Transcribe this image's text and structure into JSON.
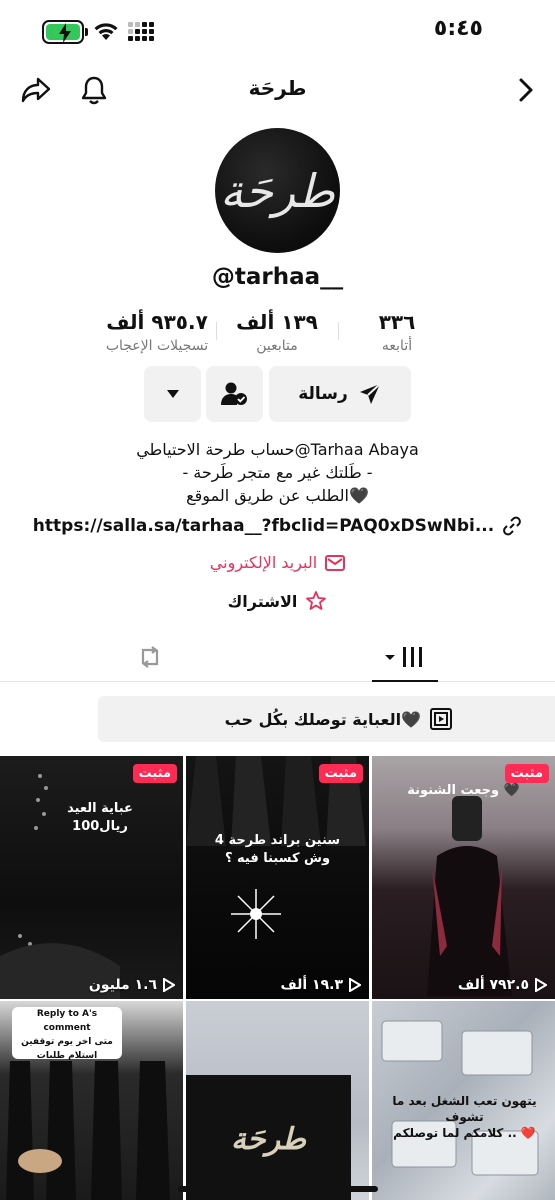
{
  "status_bar": {
    "time": "٥:٤٥"
  },
  "header": {
    "title": "طرحَة"
  },
  "profile": {
    "username": "@tarhaa__",
    "avatar_label": "طرحَة",
    "stats": [
      {
        "value": "٣٣٦",
        "label": "أتابعه"
      },
      {
        "value": "١٣٩ ألف",
        "label": "متابعين"
      },
      {
        "value": "٩٣٥.٧ ألف",
        "label": "تسجيلات الإعجاب"
      }
    ],
    "message_label": "رسالة",
    "bio_lines": [
      "حساب طرحة الاحتياطي@Tarhaa Abaya",
      "- طَلتك غير مع متجر طَرحة -",
      "الطلب عن طريق الموقع🖤"
    ],
    "link": "https://salla.sa/tarhaa__?fbclid=PAQ0xDSwNbi...",
    "email_label": "البريد الإلكتروني",
    "subscribe_label": "الاشتراك"
  },
  "playlist": {
    "label": "العباية توصلك بكُل حب🖤"
  },
  "videos": [
    {
      "badge": "مثبت",
      "views": "١.٦ مليون",
      "caption": "عباية العيد\n100ريال"
    },
    {
      "badge": "مثبت",
      "views": "١٩.٣ ألف",
      "caption": "4 سنين براند طرحة\nوش كسبنا فيه ؟"
    },
    {
      "badge": "مثبت",
      "views": "٧٩٢.٥ ألف",
      "caption": "وجعت الشنونة 🖤"
    },
    {
      "caption": "Reply to A's comment\nمتى اخر يوم توقفين\nاستلام طلبات"
    },
    {
      "caption": "طرحَة"
    },
    {
      "caption": "يتهون تعب الشغل بعد ما تشوف\nكلامكم لما توصلكم .. ❤️"
    }
  ],
  "colors": {
    "accent": "#fe2c55",
    "email": "#e3345b",
    "button_bg": "#f1f1f2"
  }
}
